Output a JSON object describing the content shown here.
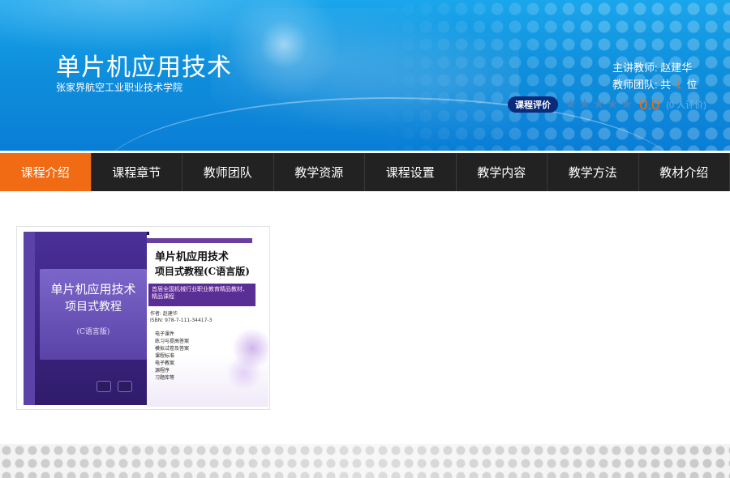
{
  "header": {
    "course_title": "单片机应用技术",
    "school_name": "张家界航空工业职业技术学院",
    "teacher_label": "主讲教师:",
    "teacher_name": "赵建华",
    "team_label": "教师团队: 共",
    "team_count": "1",
    "team_unit": "位",
    "rating_badge": "课程评价",
    "rating_score": "0.0",
    "rating_people": "(0 人评价)",
    "stars": 0,
    "max_stars": 5
  },
  "nav": {
    "tabs": [
      {
        "label": "课程介绍",
        "active": true
      },
      {
        "label": "课程章节",
        "active": false
      },
      {
        "label": "教师团队",
        "active": false
      },
      {
        "label": "教学资源",
        "active": false
      },
      {
        "label": "课程设置",
        "active": false
      },
      {
        "label": "教学内容",
        "active": false
      },
      {
        "label": "教学方法",
        "active": false
      },
      {
        "label": "教材介绍",
        "active": false
      }
    ],
    "active_color": "#f06b14",
    "bg_color": "#222222"
  },
  "book": {
    "front_title_line1": "单片机应用技术",
    "front_title_line2": "项目式教程",
    "front_edition": "(C语言版)",
    "back_title_line1": "单片机应用技术",
    "back_title_line2": "项目式教程(C语言版)",
    "back_band": "首届全国机械行业职业教育精品教材、精品课程",
    "back_author": "作者: 赵建华",
    "back_isbn": "ISBN: 978-7-111-34417-3",
    "back_list": [
      "电子课件",
      "练习与提高答案",
      "模拟试卷及答案",
      "课程标准",
      "电子教案",
      "源程序",
      "习题库等"
    ]
  },
  "colors": {
    "banner_blue": "#0f8fdc",
    "accent_orange": "#ff6a00",
    "badge_navy": "#0b2a7a"
  }
}
